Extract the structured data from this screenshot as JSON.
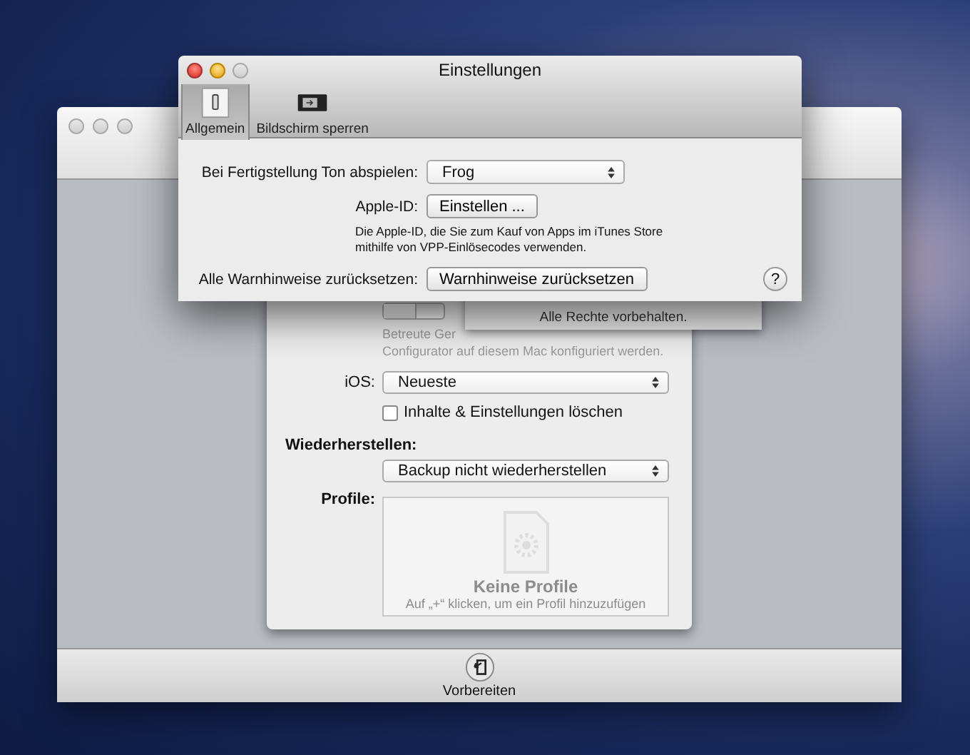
{
  "main_window": {
    "action_button": {
      "label": "Vorbereiten"
    },
    "sheet": {
      "managed_switch": {
        "on": false
      },
      "description": [
        "Betreute Ger",
        "Configurator auf diesem Mac konfiguriert werden."
      ],
      "ios": {
        "label": "iOS:",
        "value": "Neueste"
      },
      "erase": {
        "label": "Inhalte & Einstellungen löschen",
        "checked": false
      },
      "restore": {
        "label": "Wiederherstellen:",
        "value": "Backup nicht wiederherstellen"
      },
      "profiles": {
        "label": "Profile:",
        "empty_title": "Keine Profile",
        "empty_hint": "Auf „+“ klicken, um ein Profil hinzuzufügen"
      }
    },
    "about_sheet": {
      "text": "Alle Rechte vorbehalten."
    }
  },
  "preferences_window": {
    "title": "Einstellungen",
    "tabs": [
      {
        "label": "Allgemein",
        "selected": true,
        "kind": "general"
      },
      {
        "label": "Bildschirm sperren",
        "selected": false,
        "kind": "lock"
      }
    ],
    "sound": {
      "label": "Bei Fertigstellung Ton abspielen:",
      "value": "Frog"
    },
    "apple_id": {
      "label": "Apple-ID:",
      "button": "Einstellen ...",
      "note": "Die Apple-ID, die Sie zum Kauf von Apps im iTunes Store mithilfe von VPP-Einlösecodes verwenden."
    },
    "reset_warnings": {
      "label": "Alle Warnhinweise zurücksetzen:",
      "button": "Warnhinweise zurücksetzen"
    },
    "help": "?"
  }
}
